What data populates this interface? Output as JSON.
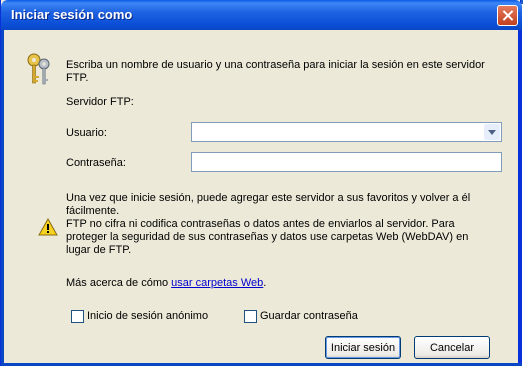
{
  "window": {
    "title": "Iniciar sesión como"
  },
  "intro": {
    "line1": "Escriba un nombre de usuario y una contraseña para iniciar la sesión en este servidor",
    "line2": "FTP."
  },
  "form": {
    "server_label": "Servidor FTP:",
    "user_label": "Usuario:",
    "user_value": "",
    "password_label": "Contraseña:",
    "password_value": ""
  },
  "info": {
    "line1": "Una vez que inicie sesión, puede agregar este servidor a sus favoritos y volver a él",
    "line2": "fácilmente."
  },
  "warning": {
    "line1": "FTP no cifra ni codifica contraseñas o datos antes de enviarlos al servidor.  Para",
    "line2": "proteger la seguridad de sus contraseñas y datos use carpetas Web (WebDAV) en",
    "line3": "lugar de FTP."
  },
  "more": {
    "prefix": "Más acerca de cómo ",
    "link": "usar carpetas Web",
    "suffix": "."
  },
  "options": {
    "anonymous_label": "Inicio de sesión anónimo",
    "anonymous_checked": false,
    "save_password_label": "Guardar contraseña",
    "save_password_checked": false
  },
  "buttons": {
    "login": "Iniciar sesión",
    "cancel": "Cancelar"
  },
  "icons": {
    "header": "keys-icon",
    "warning": "warning-icon",
    "close": "close-icon"
  },
  "colors": {
    "titlebar": "#0b4fd8",
    "dialog_bg": "#ece9d8",
    "link": "#0000cc"
  }
}
